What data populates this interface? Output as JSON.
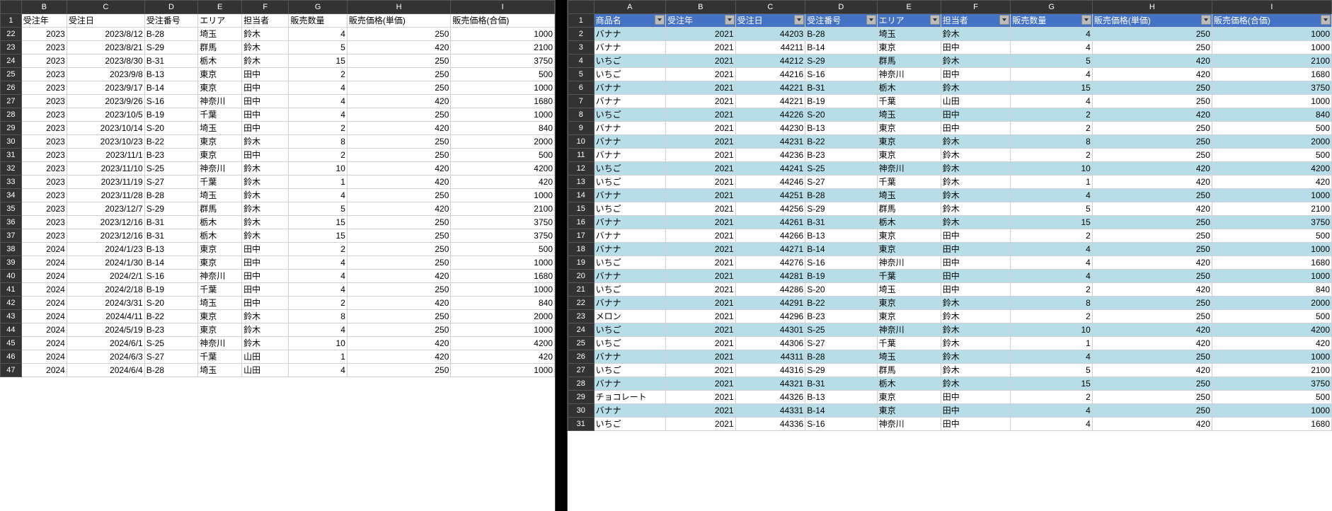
{
  "left": {
    "cols": [
      "B",
      "C",
      "D",
      "E",
      "F",
      "G",
      "H",
      "I"
    ],
    "row_start": 1,
    "headers": [
      "受注年",
      "受注日",
      "受注番号",
      "エリア",
      "担当者",
      "販売数量",
      "販売価格(単価)",
      "販売価格(合価)"
    ],
    "rows": [
      {
        "n": 22,
        "d": [
          "2023",
          "2023/8/12",
          "B-28",
          "埼玉",
          "鈴木",
          "4",
          "250",
          "1000"
        ]
      },
      {
        "n": 23,
        "d": [
          "2023",
          "2023/8/21",
          "S-29",
          "群馬",
          "鈴木",
          "5",
          "420",
          "2100"
        ]
      },
      {
        "n": 24,
        "d": [
          "2023",
          "2023/8/30",
          "B-31",
          "栃木",
          "鈴木",
          "15",
          "250",
          "3750"
        ]
      },
      {
        "n": 25,
        "d": [
          "2023",
          "2023/9/8",
          "B-13",
          "東京",
          "田中",
          "2",
          "250",
          "500"
        ]
      },
      {
        "n": 26,
        "d": [
          "2023",
          "2023/9/17",
          "B-14",
          "東京",
          "田中",
          "4",
          "250",
          "1000"
        ]
      },
      {
        "n": 27,
        "d": [
          "2023",
          "2023/9/26",
          "S-16",
          "神奈川",
          "田中",
          "4",
          "420",
          "1680"
        ]
      },
      {
        "n": 28,
        "d": [
          "2023",
          "2023/10/5",
          "B-19",
          "千葉",
          "田中",
          "4",
          "250",
          "1000"
        ]
      },
      {
        "n": 29,
        "d": [
          "2023",
          "2023/10/14",
          "S-20",
          "埼玉",
          "田中",
          "2",
          "420",
          "840"
        ]
      },
      {
        "n": 30,
        "d": [
          "2023",
          "2023/10/23",
          "B-22",
          "東京",
          "鈴木",
          "8",
          "250",
          "2000"
        ]
      },
      {
        "n": 31,
        "d": [
          "2023",
          "2023/11/1",
          "B-23",
          "東京",
          "田中",
          "2",
          "250",
          "500"
        ]
      },
      {
        "n": 32,
        "d": [
          "2023",
          "2023/11/10",
          "S-25",
          "神奈川",
          "鈴木",
          "10",
          "420",
          "4200"
        ]
      },
      {
        "n": 33,
        "d": [
          "2023",
          "2023/11/19",
          "S-27",
          "千葉",
          "鈴木",
          "1",
          "420",
          "420"
        ]
      },
      {
        "n": 34,
        "d": [
          "2023",
          "2023/11/28",
          "B-28",
          "埼玉",
          "鈴木",
          "4",
          "250",
          "1000"
        ]
      },
      {
        "n": 35,
        "d": [
          "2023",
          "2023/12/7",
          "S-29",
          "群馬",
          "鈴木",
          "5",
          "420",
          "2100"
        ]
      },
      {
        "n": 36,
        "d": [
          "2023",
          "2023/12/16",
          "B-31",
          "栃木",
          "鈴木",
          "15",
          "250",
          "3750"
        ]
      },
      {
        "n": 37,
        "d": [
          "2023",
          "2023/12/16",
          "B-31",
          "栃木",
          "鈴木",
          "15",
          "250",
          "3750"
        ]
      },
      {
        "n": 38,
        "d": [
          "2024",
          "2024/1/23",
          "B-13",
          "東京",
          "田中",
          "2",
          "250",
          "500"
        ]
      },
      {
        "n": 39,
        "d": [
          "2024",
          "2024/1/30",
          "B-14",
          "東京",
          "田中",
          "4",
          "250",
          "1000"
        ]
      },
      {
        "n": 40,
        "d": [
          "2024",
          "2024/2/1",
          "S-16",
          "神奈川",
          "田中",
          "4",
          "420",
          "1680"
        ]
      },
      {
        "n": 41,
        "d": [
          "2024",
          "2024/2/18",
          "B-19",
          "千葉",
          "田中",
          "4",
          "250",
          "1000"
        ]
      },
      {
        "n": 42,
        "d": [
          "2024",
          "2024/3/31",
          "S-20",
          "埼玉",
          "田中",
          "2",
          "420",
          "840"
        ]
      },
      {
        "n": 43,
        "d": [
          "2024",
          "2024/4/11",
          "B-22",
          "東京",
          "鈴木",
          "8",
          "250",
          "2000"
        ]
      },
      {
        "n": 44,
        "d": [
          "2024",
          "2024/5/19",
          "B-23",
          "東京",
          "鈴木",
          "4",
          "250",
          "1000"
        ]
      },
      {
        "n": 45,
        "d": [
          "2024",
          "2024/6/1",
          "S-25",
          "神奈川",
          "鈴木",
          "10",
          "420",
          "4200"
        ]
      },
      {
        "n": 46,
        "d": [
          "2024",
          "2024/6/3",
          "S-27",
          "千葉",
          "山田",
          "1",
          "420",
          "420"
        ]
      },
      {
        "n": 47,
        "d": [
          "2024",
          "2024/6/4",
          "B-28",
          "埼玉",
          "山田",
          "4",
          "250",
          "1000"
        ]
      }
    ]
  },
  "right": {
    "cols": [
      "A",
      "B",
      "C",
      "D",
      "E",
      "F",
      "G",
      "H",
      "I"
    ],
    "headers": [
      "商品名",
      "受注年",
      "受注日",
      "受注番号",
      "エリア",
      "担当者",
      "販売数量",
      "販売価格(単価)",
      "販売価格(合価)"
    ],
    "rows": [
      {
        "n": 2,
        "d": [
          "バナナ",
          "2021",
          "44203",
          "B-28",
          "埼玉",
          "鈴木",
          "4",
          "250",
          "1000"
        ]
      },
      {
        "n": 3,
        "d": [
          "バナナ",
          "2021",
          "44211",
          "B-14",
          "東京",
          "田中",
          "4",
          "250",
          "1000"
        ]
      },
      {
        "n": 4,
        "d": [
          "いちご",
          "2021",
          "44212",
          "S-29",
          "群馬",
          "鈴木",
          "5",
          "420",
          "2100"
        ]
      },
      {
        "n": 5,
        "d": [
          "いちご",
          "2021",
          "44216",
          "S-16",
          "神奈川",
          "田中",
          "4",
          "420",
          "1680"
        ]
      },
      {
        "n": 6,
        "d": [
          "バナナ",
          "2021",
          "44221",
          "B-31",
          "栃木",
          "鈴木",
          "15",
          "250",
          "3750"
        ]
      },
      {
        "n": 7,
        "d": [
          "バナナ",
          "2021",
          "44221",
          "B-19",
          "千葉",
          "山田",
          "4",
          "250",
          "1000"
        ]
      },
      {
        "n": 8,
        "d": [
          "いちご",
          "2021",
          "44226",
          "S-20",
          "埼玉",
          "田中",
          "2",
          "420",
          "840"
        ]
      },
      {
        "n": 9,
        "d": [
          "バナナ",
          "2021",
          "44230",
          "B-13",
          "東京",
          "田中",
          "2",
          "250",
          "500"
        ]
      },
      {
        "n": 10,
        "d": [
          "バナナ",
          "2021",
          "44231",
          "B-22",
          "東京",
          "鈴木",
          "8",
          "250",
          "2000"
        ]
      },
      {
        "n": 11,
        "d": [
          "バナナ",
          "2021",
          "44236",
          "B-23",
          "東京",
          "鈴木",
          "2",
          "250",
          "500"
        ]
      },
      {
        "n": 12,
        "d": [
          "いちご",
          "2021",
          "44241",
          "S-25",
          "神奈川",
          "鈴木",
          "10",
          "420",
          "4200"
        ]
      },
      {
        "n": 13,
        "d": [
          "いちご",
          "2021",
          "44246",
          "S-27",
          "千葉",
          "鈴木",
          "1",
          "420",
          "420"
        ]
      },
      {
        "n": 14,
        "d": [
          "バナナ",
          "2021",
          "44251",
          "B-28",
          "埼玉",
          "鈴木",
          "4",
          "250",
          "1000"
        ]
      },
      {
        "n": 15,
        "d": [
          "いちご",
          "2021",
          "44256",
          "S-29",
          "群馬",
          "鈴木",
          "5",
          "420",
          "2100"
        ]
      },
      {
        "n": 16,
        "d": [
          "バナナ",
          "2021",
          "44261",
          "B-31",
          "栃木",
          "鈴木",
          "15",
          "250",
          "3750"
        ]
      },
      {
        "n": 17,
        "d": [
          "バナナ",
          "2021",
          "44266",
          "B-13",
          "東京",
          "田中",
          "2",
          "250",
          "500"
        ]
      },
      {
        "n": 18,
        "d": [
          "バナナ",
          "2021",
          "44271",
          "B-14",
          "東京",
          "田中",
          "4",
          "250",
          "1000"
        ]
      },
      {
        "n": 19,
        "d": [
          "いちご",
          "2021",
          "44276",
          "S-16",
          "神奈川",
          "田中",
          "4",
          "420",
          "1680"
        ]
      },
      {
        "n": 20,
        "d": [
          "バナナ",
          "2021",
          "44281",
          "B-19",
          "千葉",
          "田中",
          "4",
          "250",
          "1000"
        ]
      },
      {
        "n": 21,
        "d": [
          "いちご",
          "2021",
          "44286",
          "S-20",
          "埼玉",
          "田中",
          "2",
          "420",
          "840"
        ]
      },
      {
        "n": 22,
        "d": [
          "バナナ",
          "2021",
          "44291",
          "B-22",
          "東京",
          "鈴木",
          "8",
          "250",
          "2000"
        ]
      },
      {
        "n": 23,
        "d": [
          "メロン",
          "2021",
          "44296",
          "B-23",
          "東京",
          "鈴木",
          "2",
          "250",
          "500"
        ]
      },
      {
        "n": 24,
        "d": [
          "いちご",
          "2021",
          "44301",
          "S-25",
          "神奈川",
          "鈴木",
          "10",
          "420",
          "4200"
        ]
      },
      {
        "n": 25,
        "d": [
          "いちご",
          "2021",
          "44306",
          "S-27",
          "千葉",
          "鈴木",
          "1",
          "420",
          "420"
        ]
      },
      {
        "n": 26,
        "d": [
          "バナナ",
          "2021",
          "44311",
          "B-28",
          "埼玉",
          "鈴木",
          "4",
          "250",
          "1000"
        ]
      },
      {
        "n": 27,
        "d": [
          "いちご",
          "2021",
          "44316",
          "S-29",
          "群馬",
          "鈴木",
          "5",
          "420",
          "2100"
        ]
      },
      {
        "n": 28,
        "d": [
          "バナナ",
          "2021",
          "44321",
          "B-31",
          "栃木",
          "鈴木",
          "15",
          "250",
          "3750"
        ]
      },
      {
        "n": 29,
        "d": [
          "チョコレート",
          "2021",
          "44326",
          "B-13",
          "東京",
          "田中",
          "2",
          "250",
          "500"
        ]
      },
      {
        "n": 30,
        "d": [
          "バナナ",
          "2021",
          "44331",
          "B-14",
          "東京",
          "田中",
          "4",
          "250",
          "1000"
        ]
      },
      {
        "n": 31,
        "d": [
          "いちご",
          "2021",
          "44336",
          "S-16",
          "神奈川",
          "田中",
          "4",
          "420",
          "1680"
        ]
      }
    ]
  }
}
